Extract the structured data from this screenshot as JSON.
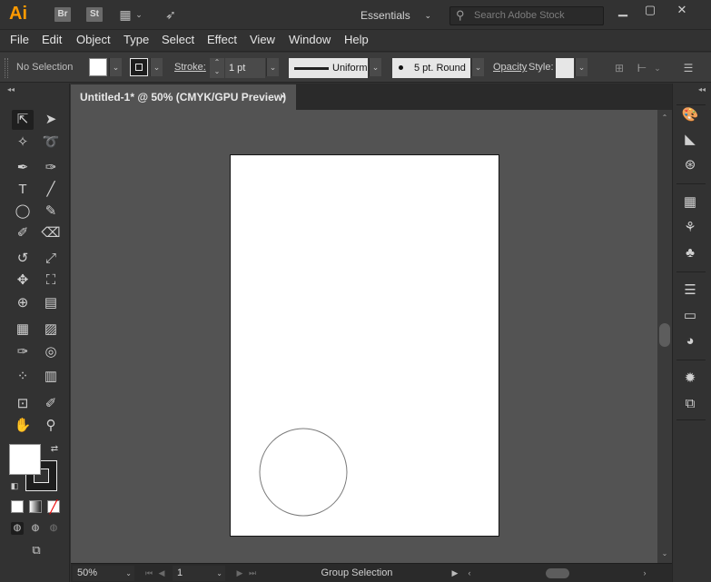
{
  "app": {
    "logo": "Ai",
    "bridge": "Br",
    "stock": "St",
    "workspace": "Essentials",
    "search_placeholder": "Search Adobe Stock",
    "accent": "#ff9a00"
  },
  "menu": [
    "File",
    "Edit",
    "Object",
    "Type",
    "Select",
    "Effect",
    "View",
    "Window",
    "Help"
  ],
  "control": {
    "selection": "No Selection",
    "stroke_label": "Stroke:",
    "stroke_value": "1 pt",
    "profile": "Uniform",
    "brush": "5 pt. Round",
    "opacity_label": "Opacity",
    "style_label": "Style:"
  },
  "document": {
    "tab_title": "Untitled-1* @ 50% (CMYK/GPU Preview)",
    "close": "×"
  },
  "status": {
    "zoom": "50%",
    "page": "1",
    "tool": "Group Selection"
  },
  "icons": {
    "layout": "workspace-layout-icon",
    "rocket": "publish-icon"
  }
}
